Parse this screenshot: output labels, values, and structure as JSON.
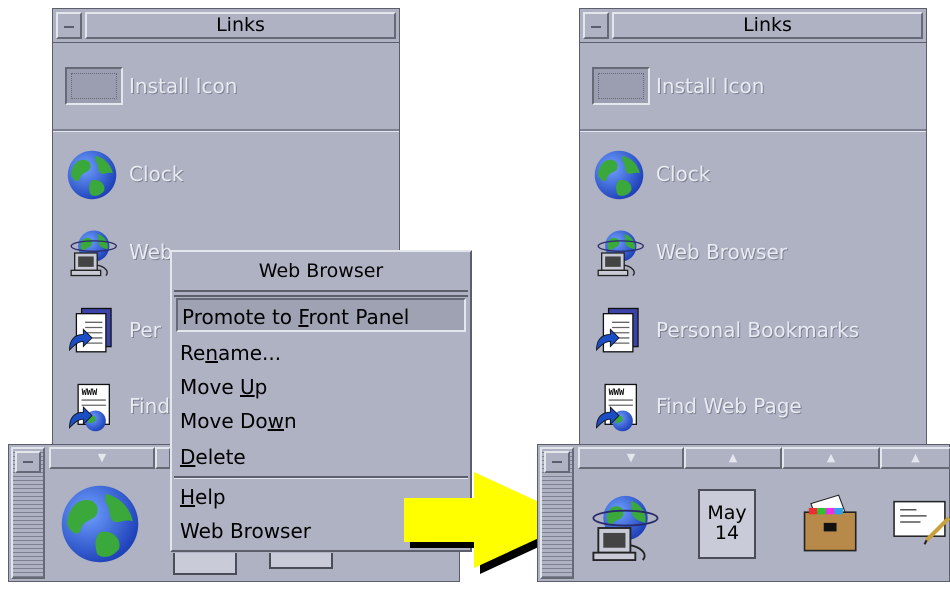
{
  "left_panel": {
    "title": "Links",
    "items": [
      {
        "label": "Install Icon"
      },
      {
        "label": "Clock"
      },
      {
        "label": "Web Browser"
      },
      {
        "label": "Personal Bookmarks"
      },
      {
        "label": "Find Web Page"
      }
    ],
    "visible_labels": [
      "Install Icon",
      "Clock",
      "Web",
      "Per",
      "Find"
    ]
  },
  "popup_menu": {
    "title": "Web Browser",
    "items": [
      {
        "pre": "Promote to ",
        "mn": "F",
        "post": "ront Panel",
        "selected": true
      },
      {
        "pre": "Re",
        "mn": "n",
        "post": "ame..."
      },
      {
        "pre": "Move ",
        "mn": "U",
        "post": "p"
      },
      {
        "pre": "Move Do",
        "mn": "w",
        "post": "n"
      },
      {
        "pre": "",
        "mn": "D",
        "post": "elete"
      },
      {
        "pre": "",
        "mn": "H",
        "post": "elp"
      },
      {
        "pre": "Web Browser",
        "mn": "",
        "post": ""
      }
    ]
  },
  "right_panel": {
    "title": "Links",
    "items": [
      {
        "label": "Install Icon"
      },
      {
        "label": "Clock"
      },
      {
        "label": "Web Browser"
      },
      {
        "label": "Personal Bookmarks"
      },
      {
        "label": "Find Web Page"
      }
    ]
  },
  "front_panel_right": {
    "calendar_month": "May",
    "calendar_day": "14"
  },
  "colors": {
    "panel": "#aeb2c3",
    "arrow": "#ffff00"
  },
  "icons": [
    "globe-icon",
    "web-browser-icon",
    "bookmarks-icon",
    "find-web-page-icon",
    "calendar-icon",
    "file-manager-icon",
    "text-editor-icon"
  ]
}
